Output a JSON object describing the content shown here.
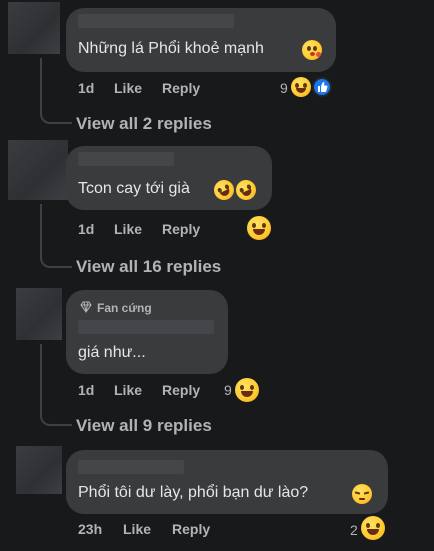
{
  "comments": [
    {
      "text": "Những lá Phổi khoẻ mạnh",
      "time": "1d",
      "like_label": "Like",
      "reply_label": "Reply",
      "reaction_count": "9",
      "view_replies": "View all 2 replies"
    },
    {
      "text": "Tcon cay tới già",
      "time": "1d",
      "like_label": "Like",
      "reply_label": "Reply",
      "view_replies": "View all 16 replies"
    },
    {
      "badge": "Fan cứng",
      "text": "giá như...",
      "time": "1d",
      "like_label": "Like",
      "reply_label": "Reply",
      "reaction_count": "9",
      "view_replies": "View all 9 replies"
    },
    {
      "text": "Phổi tôi dư lày, phổi bạn dư lào?",
      "time": "23h",
      "like_label": "Like",
      "reply_label": "Reply",
      "reaction_count": "2"
    }
  ],
  "icons": {
    "reaction": "grinning-squinting-face-icon",
    "like": "thumbs-up-icon",
    "laughing": "rolling-on-floor-laughing-icon",
    "kiss": "face-blowing-kiss-icon",
    "pensive": "pensive-face-icon",
    "diamond": "diamond-icon"
  },
  "colors": {
    "background": "#18191a",
    "bubble": "#3a3b3c",
    "text": "#e4e6eb",
    "secondary_text": "#b0b3b8",
    "like_blue": "#1877f2"
  }
}
